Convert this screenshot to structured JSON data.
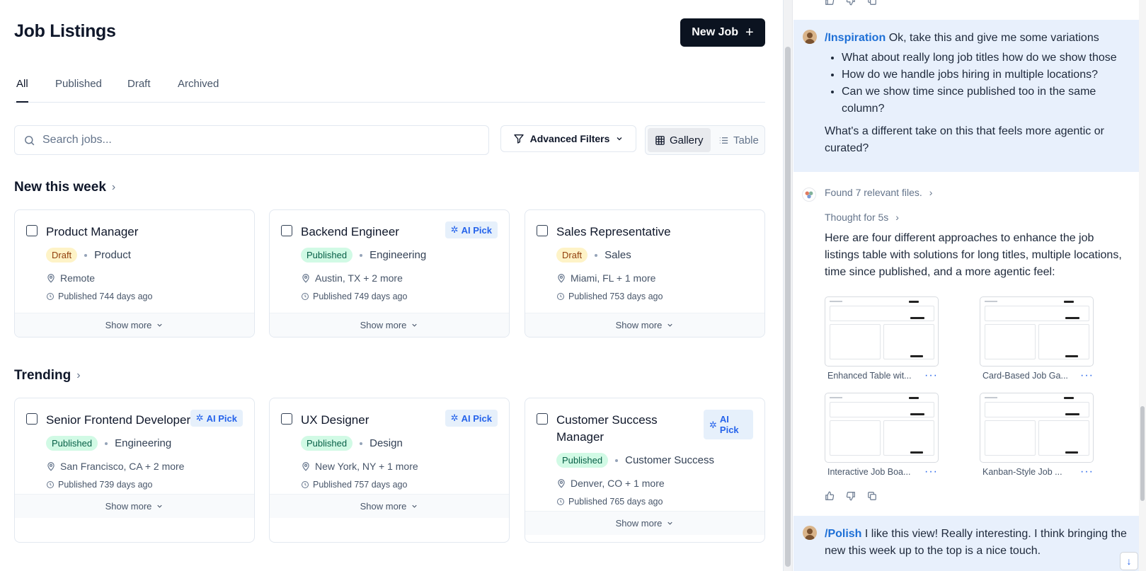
{
  "header": {
    "title": "Job Listings",
    "new_job_label": "New Job"
  },
  "tabs": [
    {
      "label": "All",
      "active": true
    },
    {
      "label": "Published"
    },
    {
      "label": "Draft"
    },
    {
      "label": "Archived"
    }
  ],
  "search": {
    "placeholder": "Search jobs..."
  },
  "filters": {
    "advanced_label": "Advanced Filters"
  },
  "view_toggle": {
    "gallery_label": "Gallery",
    "table_label": "Table",
    "selected": "Gallery"
  },
  "sections": [
    {
      "title": "New this week",
      "jobs": [
        {
          "title": "Product Manager",
          "status": "Draft",
          "department": "Product",
          "location": "Remote",
          "published": "Published 744 days ago",
          "ai_pick": false,
          "show_more": "Show more"
        },
        {
          "title": "Backend Engineer",
          "status": "Published",
          "department": "Engineering",
          "location": "Austin, TX + 2 more",
          "published": "Published 749 days ago",
          "ai_pick": true,
          "show_more": "Show more"
        },
        {
          "title": "Sales Representative",
          "status": "Draft",
          "department": "Sales",
          "location": "Miami, FL + 1 more",
          "published": "Published 753 days ago",
          "ai_pick": false,
          "show_more": "Show more"
        }
      ]
    },
    {
      "title": "Trending",
      "jobs": [
        {
          "title": "Senior Frontend Developer",
          "status": "Published",
          "department": "Engineering",
          "location": "San Francisco, CA + 2 more",
          "published": "Published 739 days ago",
          "ai_pick": true,
          "show_more": "Show more"
        },
        {
          "title": "UX Designer",
          "status": "Published",
          "department": "Design",
          "location": "New York, NY + 1 more",
          "published": "Published 757 days ago",
          "ai_pick": true,
          "show_more": "Show more"
        },
        {
          "title": "Customer Success Manager",
          "title_line1": "Customer Success",
          "title_line2": "Manager",
          "status": "Published",
          "department": "Customer Success",
          "location": "Denver, CO + 1 more",
          "published": "Published 765 days ago",
          "ai_pick": true,
          "show_more": "Show more"
        }
      ]
    }
  ],
  "ai_pick_label": "AI Pick",
  "ai_pick_label_line1": "AI",
  "ai_pick_label_line2": "Pick",
  "chat": {
    "message1": {
      "command": "/Inspiration",
      "text": "Ok, take this and give me some variations",
      "bullets": [
        "What about really long job titles how do we show those",
        "How do we handle jobs hiring in multiple locations?",
        "Can we show time since published too in the same column?"
      ],
      "followup": "What's a different take on this that feels more agentic or curated?"
    },
    "assistant": {
      "files_found": "Found 7 relevant files.",
      "thought": "Thought for 5s",
      "body": "Here are four different approaches to enhance the job listings table with solutions for long titles, multiple locations, time since published, and a more agentic feel:",
      "previews": [
        {
          "label": "Enhanced Table wit..."
        },
        {
          "label": "Card-Based Job Ga..."
        },
        {
          "label": "Interactive Job Boa..."
        },
        {
          "label": "Kanban-Style Job ..."
        }
      ]
    },
    "message2": {
      "command": "/Polish",
      "text": "I like this view! Really interesting. I think bringing the new this week up to the top is a nice touch."
    }
  },
  "colors": {
    "primary_button": "#0b1320",
    "accent_blue": "#2563eb",
    "draft_badge": "#fef3c7",
    "published_badge": "#d1fae5",
    "user_message_bg": "#e8f0fc"
  }
}
